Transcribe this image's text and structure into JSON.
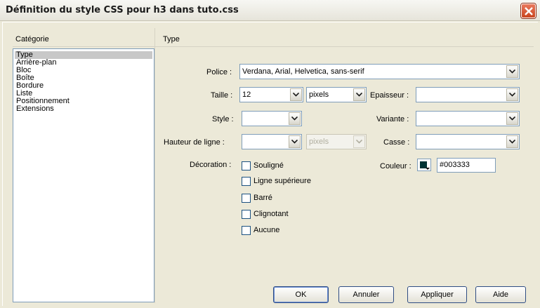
{
  "window": {
    "title": "Définition du style CSS pour h3 dans tuto.css"
  },
  "category_header": "Catégorie",
  "panel_header": "Type",
  "categories": [
    {
      "label": "Type",
      "selected": true
    },
    {
      "label": "Arrière-plan",
      "selected": false
    },
    {
      "label": "Bloc",
      "selected": false
    },
    {
      "label": "Boîte",
      "selected": false
    },
    {
      "label": "Bordure",
      "selected": false
    },
    {
      "label": "Liste",
      "selected": false
    },
    {
      "label": "Positionnement",
      "selected": false
    },
    {
      "label": "Extensions",
      "selected": false
    }
  ],
  "form": {
    "font_label": "Police :",
    "font_value": "Verdana, Arial, Helvetica, sans-serif",
    "size_label": "Taille :",
    "size_value": "12",
    "size_unit": "pixels",
    "weight_label": "Epaisseur :",
    "weight_value": "",
    "style_label": "Style :",
    "style_value": "",
    "variant_label": "Variante :",
    "variant_value": "",
    "line_height_label": "Hauteur de ligne :",
    "line_height_value": "",
    "line_height_unit": "pixels",
    "case_label": "Casse :",
    "case_value": "",
    "decoration_label": "Décoration :",
    "decorations": [
      "Souligné",
      "Ligne supérieure",
      "Barré",
      "Clignotant",
      "Aucune"
    ],
    "color_label": "Couleur :",
    "color_value": "#003333"
  },
  "buttons": {
    "ok": "OK",
    "cancel": "Annuler",
    "apply": "Appliquer",
    "help": "Aide"
  },
  "colors": {
    "swatch": "#003333",
    "selection": "#c8c8c8",
    "border": "#7f9db9"
  },
  "icons": {
    "close": "close-icon",
    "dropdown": "chevron-down-icon",
    "swatch_arrow": "triangle-down-icon"
  }
}
